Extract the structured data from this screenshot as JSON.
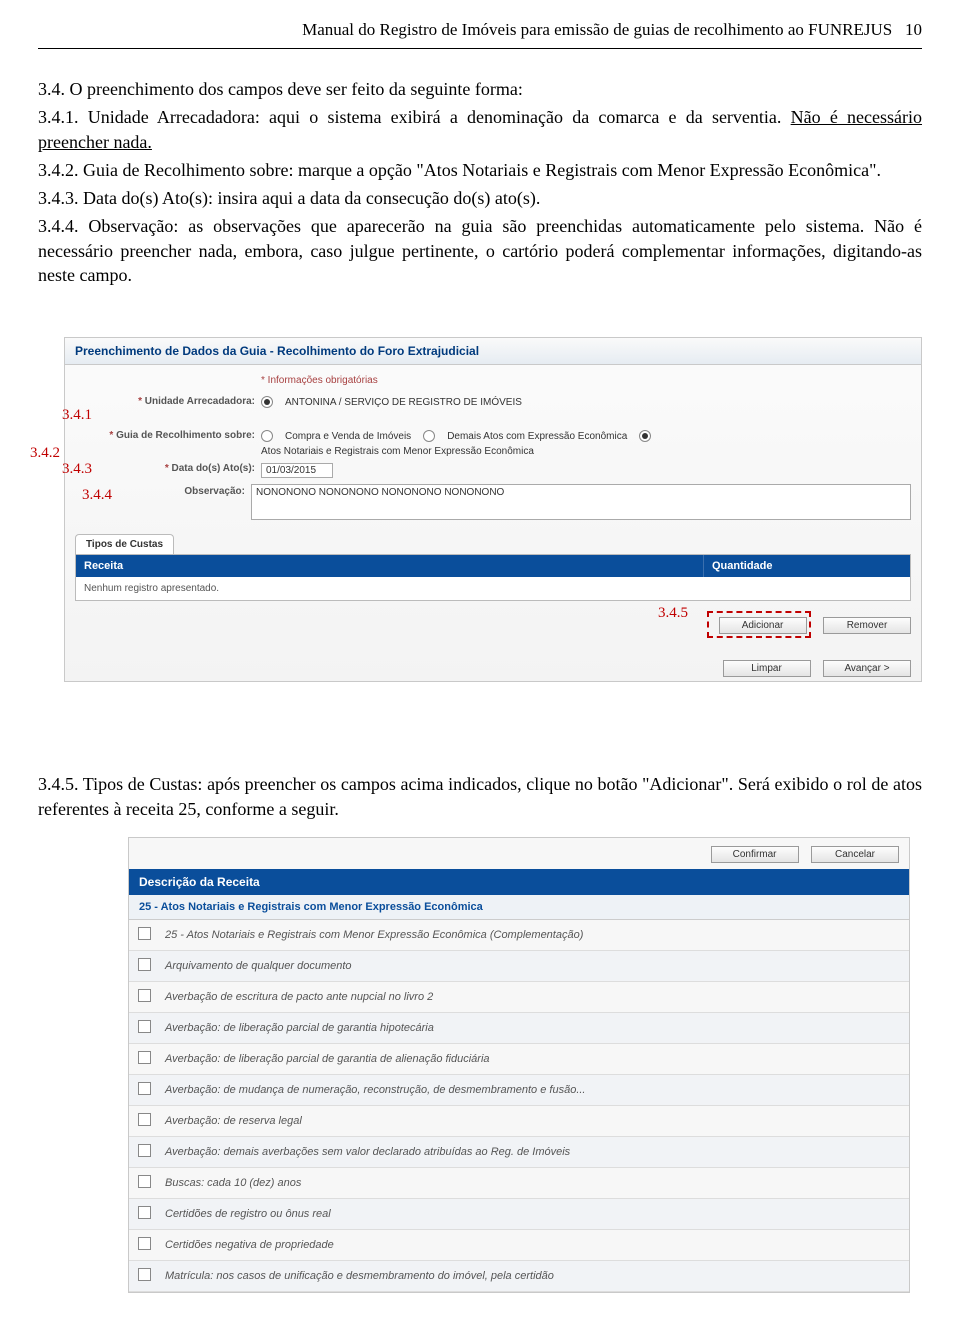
{
  "header": {
    "running": "Manual do Registro de Imóveis para emissão de guias de recolhimento ao FUNREJUS",
    "page_number": "10"
  },
  "doc": {
    "p1": "3.4. O preenchimento dos campos deve ser feito da seguinte forma:",
    "p2a": "3.4.1. Unidade Arrecadadora: aqui o sistema exibirá a denominação da comarca e da serventia. ",
    "p2b": "Não é necessário preencher nada.",
    "p3a": "3.4.2. Guia de Recolhimento sobre: ",
    "p3b": "marque a opção \"Atos Notariais e Registrais com Menor Expressão Econômica\".",
    "p4a": "3.4.3. Data do(s) Ato(s): ",
    "p4b": "insira aqui a data da consecução do(s) ato(s).",
    "p5a": "3.4.4. Observação: ",
    "p5b": "as observações que aparecerão na guia são preenchidas automaticamente pelo sistema. Não é necessário preencher nada, embora, caso julgue pertinente, o cartório poderá complementar informações, digitando-as neste campo.",
    "p6a": "3.4.5. Tipos de Custas: ",
    "p6b": "após preencher os campos acima indicados, clique no botão \"Adicionar\". Será exibido o rol de atos referentes à receita 25, conforme a seguir."
  },
  "callouts": {
    "c1": "3.4.1",
    "c2": "3.4.2",
    "c3": "3.4.3",
    "c4": "3.4.4",
    "c5": "3.4.5"
  },
  "form": {
    "panel_title": "Preenchimento de Dados da Guia - Recolhimento do Foro Extrajudicial",
    "required_note": "* Informações obrigatórias",
    "labels": {
      "unidade": "Unidade Arrecadadora:",
      "guia_sobre": "Guia de Recolhimento sobre:",
      "data_ato": "Data do(s) Ato(s):",
      "observacao": "Observação:"
    },
    "unidade_value": "ANTONINA / SERVIÇO DE REGISTRO DE IMÓVEIS",
    "guia_opts": {
      "opt1": "Compra e Venda de Imóveis",
      "opt2": "Demais Atos com Expressão Econômica",
      "opt3": "Atos Notariais e Registrais com Menor Expressão Econômica"
    },
    "data_value": "01/03/2015",
    "obs_value": "NONONONO NONONONO NONONONO NONONONO",
    "tab_label": "Tipos de Custas",
    "grid_cols": {
      "receita": "Receita",
      "qtd": "Quantidade"
    },
    "grid_empty": "Nenhum registro apresentado.",
    "buttons": {
      "adicionar": "Adicionar",
      "remover": "Remover",
      "limpar": "Limpar",
      "avancar": "Avançar >"
    }
  },
  "receita_panel": {
    "buttons": {
      "confirmar": "Confirmar",
      "cancelar": "Cancelar"
    },
    "header": "Descrição da Receita",
    "subheader": "25 - Atos Notariais e Registrais com Menor Expressão Econômica",
    "items": [
      "25 - Atos Notariais e Registrais com Menor Expressão Econômica (Complementação)",
      "Arquivamento de qualquer documento",
      "Averbação de escritura de pacto ante nupcial no livro 2",
      "Averbação: de liberação parcial de garantia hipotecária",
      "Averbação: de liberação parcial de garantia de alienação fiduciária",
      "Averbação: de mudança de numeração, reconstrução, de desmembramento e fusão...",
      "Averbação: de reserva legal",
      "Averbação: demais averbações sem valor declarado atribuídas ao Reg. de Imóveis",
      "Buscas: cada 10 (dez) anos",
      "Certidões de registro ou ônus real",
      "Certidões negativa de propriedade",
      "Matrícula: nos casos de unificação e desmembramento do imóvel, pela certidão"
    ]
  }
}
